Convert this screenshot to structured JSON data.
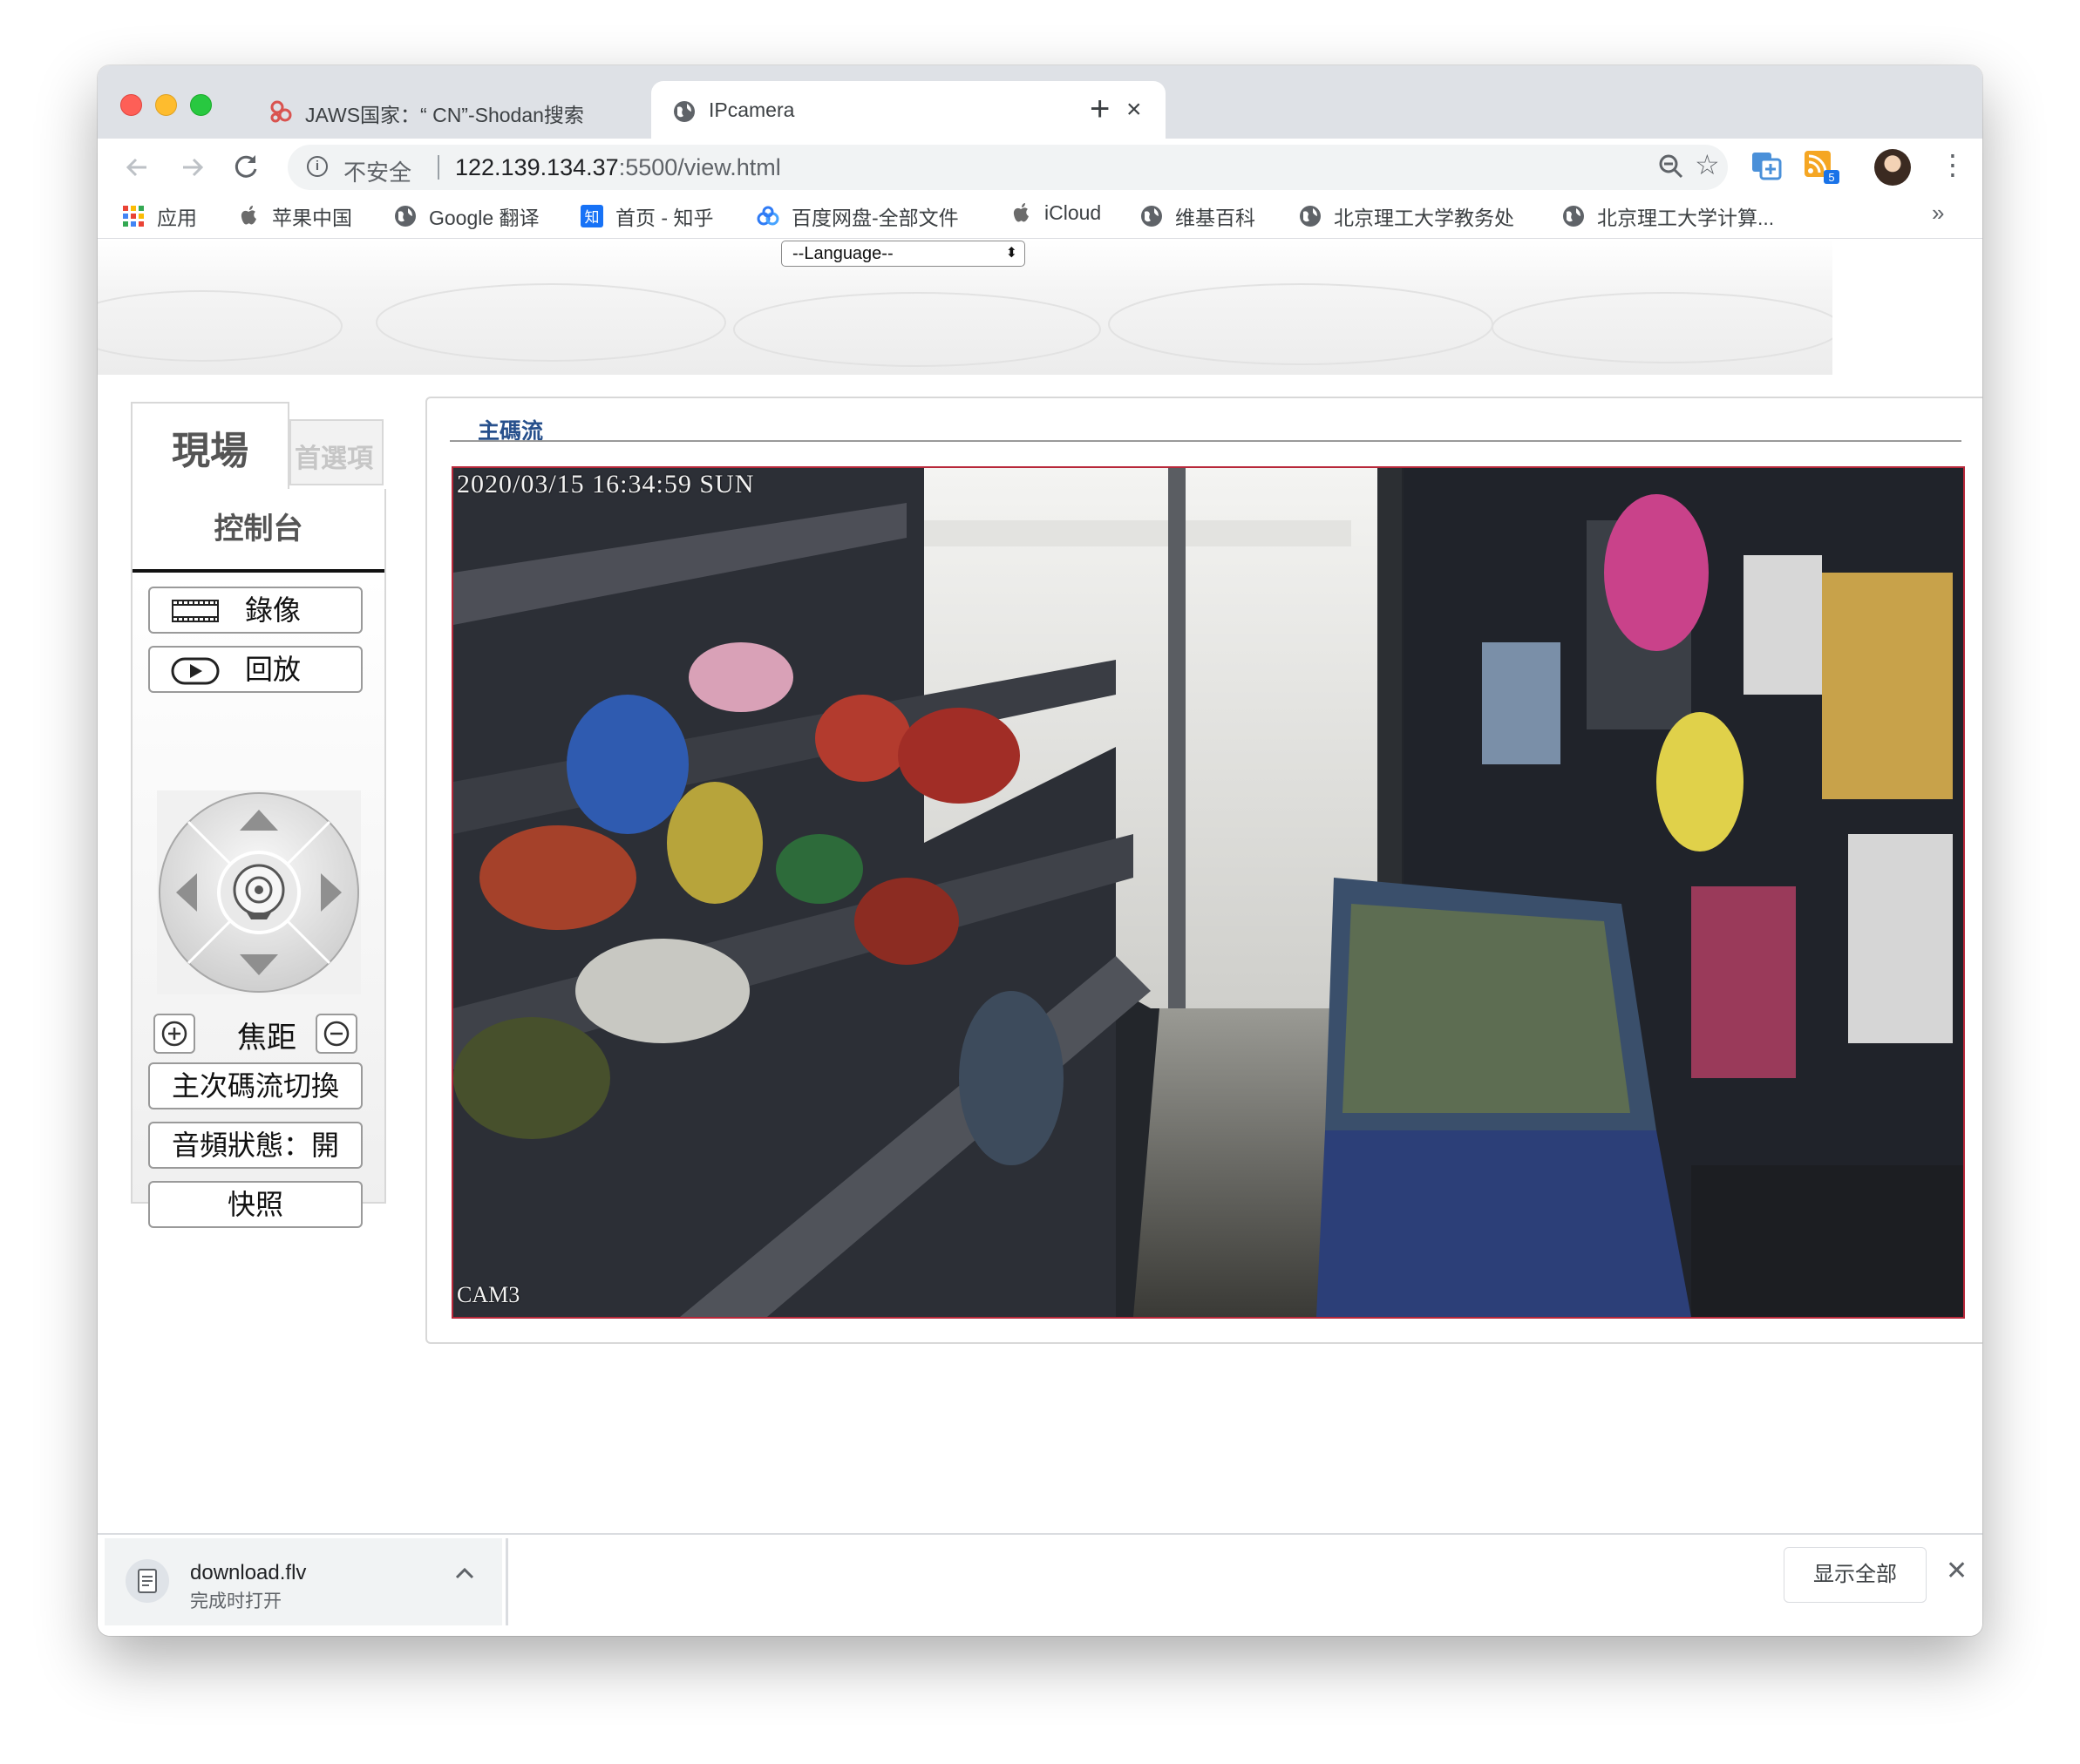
{
  "browser": {
    "tabs": [
      {
        "title": "JAWS国家：“ CN”-Shodan搜索",
        "active": false,
        "favicon": "shodan-icon"
      },
      {
        "title": "IPcamera",
        "active": true,
        "favicon": "globe-icon"
      }
    ],
    "address": {
      "security_label": "不安全",
      "url_host": "122.139.134.37",
      "url_rest": ":5500/view.html"
    },
    "bookmarks": [
      {
        "label": "应用",
        "icon": "apps-grid-icon"
      },
      {
        "label": "苹果中国",
        "icon": "apple-icon"
      },
      {
        "label": "Google 翻译",
        "icon": "globe-icon"
      },
      {
        "label": "首页 - 知乎",
        "icon": "zhihu-icon"
      },
      {
        "label": "百度网盘-全部文件",
        "icon": "baidu-pan-icon"
      },
      {
        "label": "iCloud",
        "icon": "apple-icon"
      },
      {
        "label": "维基百科",
        "icon": "globe-icon"
      },
      {
        "label": "北京理工大学教务处",
        "icon": "globe-icon"
      },
      {
        "label": "北京理工大学计算...",
        "icon": "globe-icon"
      }
    ],
    "bookmarks_more": "»",
    "extension_badge": "5"
  },
  "page": {
    "language_select": "--Language--",
    "tabs": {
      "live": "現場",
      "preferences": "首選項"
    },
    "console_title": "控制台",
    "buttons": {
      "record": "錄像",
      "playback": "回放",
      "zoom_label": "焦距",
      "stream_switch": "主次碼流切換",
      "audio_status": "音頻狀態：開",
      "snapshot": "快照"
    },
    "stream_title": "主碼流",
    "video": {
      "timestamp": "2020/03/15 16:34:59 SUN",
      "camera_label": "CAM3"
    }
  },
  "download_bar": {
    "filename": "download.flv",
    "status": "完成时打开",
    "show_all": "显示全部"
  },
  "colors": {
    "accent_blue": "#27508c",
    "video_border": "#b8283a",
    "tabstrip": "#dee1e6"
  }
}
